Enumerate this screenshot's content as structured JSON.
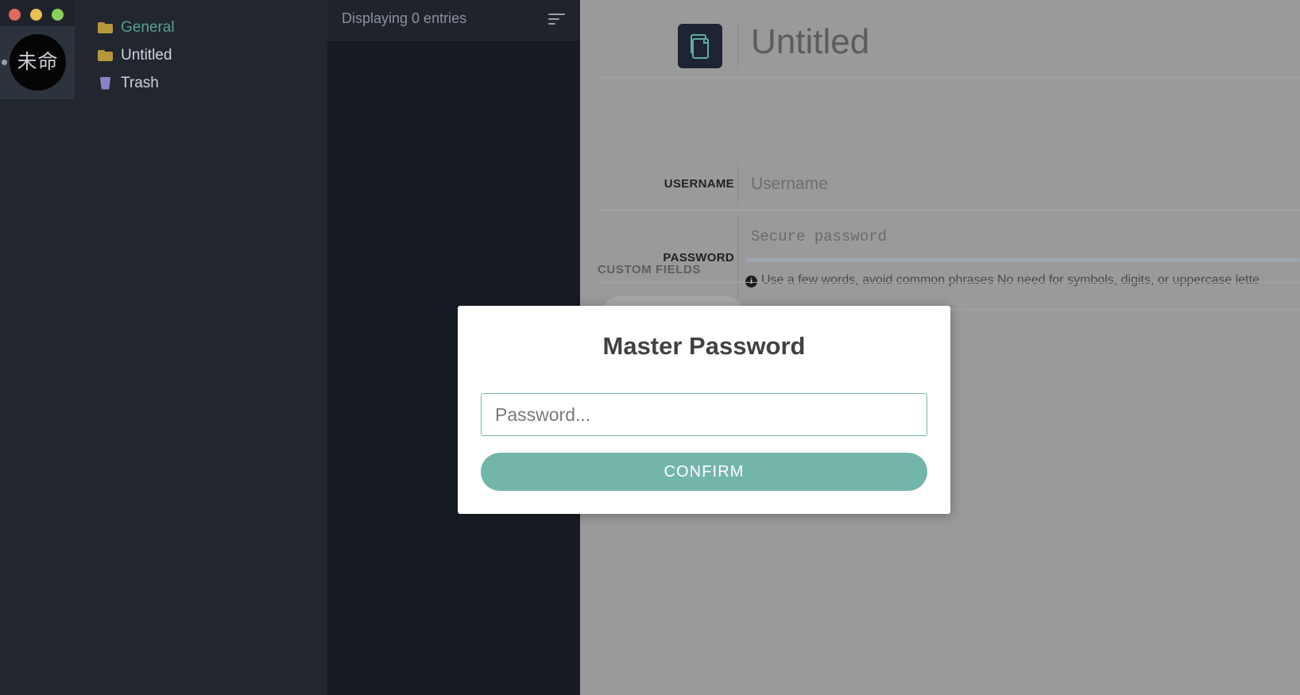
{
  "window": {
    "controls": [
      {
        "name": "close",
        "color": "#e0695f"
      },
      {
        "name": "minimize",
        "color": "#e8c24f"
      },
      {
        "name": "maximize",
        "color": "#8bcf5b"
      }
    ]
  },
  "rail": {
    "vault_avatar_label": "未命"
  },
  "sidebar": {
    "items": [
      {
        "label": "General",
        "icon": "folder-icon",
        "selected": true
      },
      {
        "label": "Untitled",
        "icon": "folder-icon",
        "selected": false
      },
      {
        "label": "Trash",
        "icon": "trash-icon",
        "selected": false
      }
    ]
  },
  "entries": {
    "count_text": "Displaying 0 entries",
    "sort_icon": "sort-descending-icon"
  },
  "detail": {
    "entry_icon": "copy-document-icon",
    "title": "Untitled",
    "fields": [
      {
        "label": "USERNAME",
        "value": "Username",
        "mono": false
      },
      {
        "label": "PASSWORD",
        "value": "Secure password",
        "mono": true
      }
    ],
    "password_hint": "Use a few words, avoid common phrases No need for symbols, digits, or uppercase lette",
    "hint_icon": "info-icon",
    "custom_fields_title": "CUSTOM FIELDS",
    "add_field_label": ""
  },
  "modal": {
    "title": "Master Password",
    "password_placeholder": "Password...",
    "password_value": "",
    "confirm_label": "CONFIRM",
    "accent_color": "#74b5aa",
    "border_color": "#76b9ab"
  }
}
